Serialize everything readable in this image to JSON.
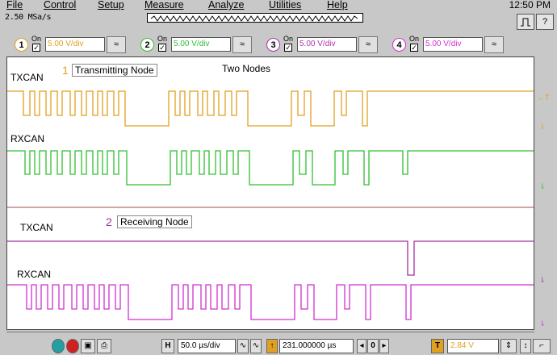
{
  "menu": [
    "File",
    "Control",
    "Setup",
    "Measure",
    "Analyze",
    "Utilities",
    "Help"
  ],
  "clock": "12:50 PM",
  "sample_rate": "2.50 MSa/s",
  "channels": [
    {
      "num": "1",
      "on": "On",
      "vdiv": "5.00 V/div",
      "color": "#e0a020"
    },
    {
      "num": "2",
      "on": "On",
      "vdiv": "5.00 V/div",
      "color": "#30c030"
    },
    {
      "num": "3",
      "on": "On",
      "vdiv": "5.00 V/div",
      "color": "#b030b0"
    },
    {
      "num": "4",
      "on": "On",
      "vdiv": "5.00 V/div",
      "color": "#d030d0"
    }
  ],
  "screen": {
    "title": "Two Nodes",
    "tx1": "TXCAN",
    "rx1": "RXCAN",
    "tx2": "TXCAN",
    "rx2": "RXCAN",
    "box1_num": "1",
    "box1": "Transmitting Node",
    "box2_num": "2",
    "box2": "Receiving Node",
    "marker_T": "T"
  },
  "bottom": {
    "h_label": "H",
    "time_div": "50.0 µs/div",
    "delay": "231.000000 µs",
    "zero": "0",
    "trig_label": "T",
    "trig_level": "2.84 V"
  }
}
